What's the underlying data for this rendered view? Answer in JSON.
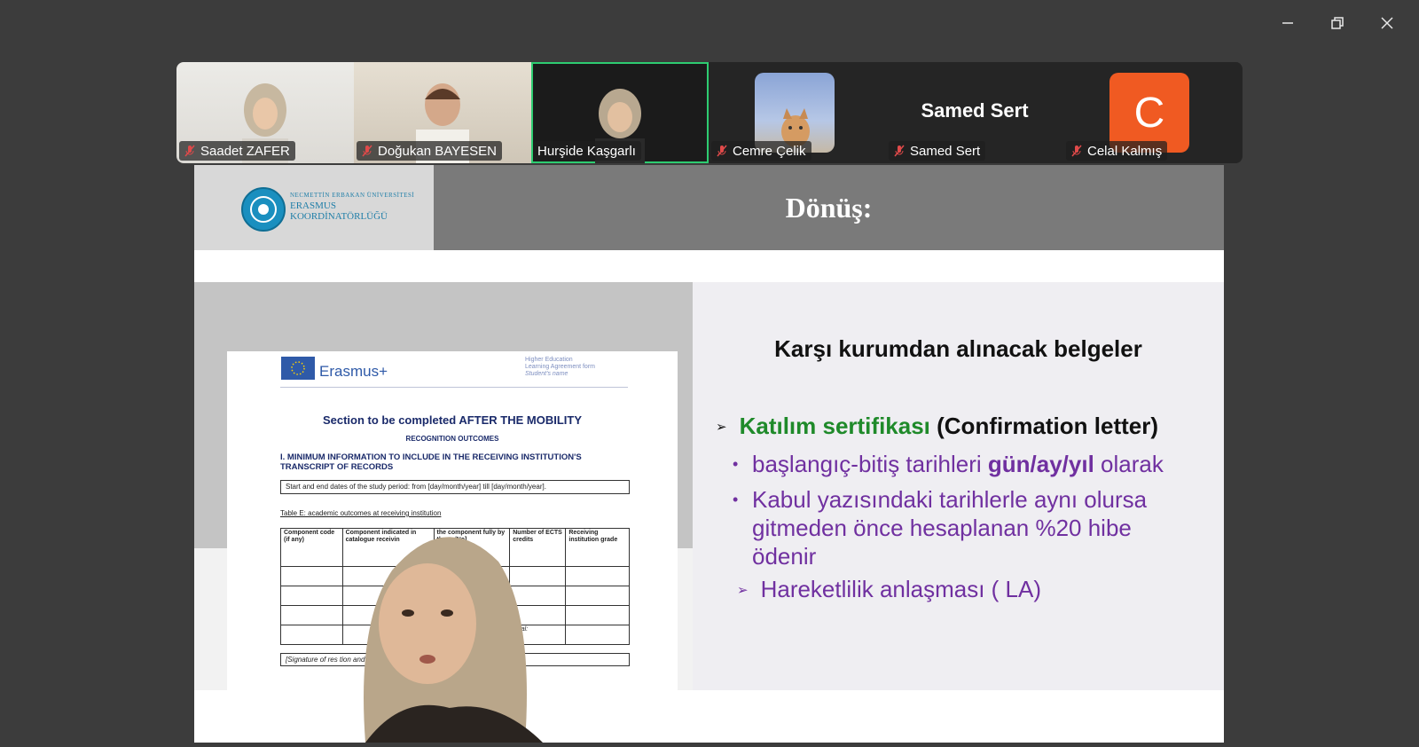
{
  "window": {
    "controls": [
      "minimize-icon",
      "restore-icon",
      "close-icon"
    ]
  },
  "participants": [
    {
      "name": "Saadet ZAFER",
      "muted": true,
      "video": true
    },
    {
      "name": "Doğukan BAYESEN",
      "muted": true,
      "video": true
    },
    {
      "name": "Hurşide Kaşgarlı",
      "muted": false,
      "video": true,
      "active_speaker": true
    },
    {
      "name": "Cemre Çelik",
      "muted": true,
      "video": false,
      "avatar": "cat-photo"
    },
    {
      "name": "Samed Sert",
      "muted": true,
      "video": false,
      "display_name": "Samed Sert"
    },
    {
      "name": "Celal Kalmış",
      "muted": true,
      "video": false,
      "avatar_letter": "C",
      "avatar_color": "#f05a22"
    }
  ],
  "slide": {
    "logo": {
      "university": "NECMETTİN ERBAKAN ÜNİVERSİTESİ",
      "line1": "ERASMUS",
      "line2": "KOORDİNATÖRLÜĞÜ"
    },
    "title": "Dönüş:",
    "heading": "Karşı kurumdan alınacak belgeler",
    "main_bullet": {
      "green": "Katılım sertifikası",
      "black": "(Confirmation letter)"
    },
    "sub_bullets": [
      {
        "pre": "başlangıç-bitiş tarihleri ",
        "bold": "gün/ay/yıl",
        "post": " olarak"
      },
      {
        "pre": "Kabul yazısındaki tarihlerle aynı olursa gitmeden önce hesaplanan %20 hibe ödenir",
        "bold": "",
        "post": ""
      }
    ],
    "second_bullet": "Hareketlilik anlaşması ( LA)",
    "colors": {
      "green": "#1f8a2a",
      "purple": "#7030a0",
      "header": "#7a7a7a"
    }
  },
  "document": {
    "brand": "Erasmus+",
    "header_right": [
      "Higher Education",
      "Learning Agreement form",
      "Student's name"
    ],
    "section_title_pre": "Section to be completed ",
    "section_title_bold": "AFTER THE MOBILITY",
    "recognition": "RECOGNITION OUTCOMES",
    "minimum_info": "I.  MINIMUM INFORMATION TO INCLUDE IN THE RECEIVING INSTITUTION'S TRANSCRIPT OF RECORDS",
    "dates_line": "Start and end dates of the study period: from [day/month/year] till [day/month/year].",
    "table_caption": "Table E: academic outcomes at receiving institution",
    "columns": [
      "Component code (if any)",
      "Component indicated in catalogue receivin",
      "the component fully by the es/No]",
      "Number of ECTS credits",
      "Receiving institution grade"
    ],
    "total_label": "Total:",
    "signature": "[Signature of res                                            tion and date]"
  }
}
